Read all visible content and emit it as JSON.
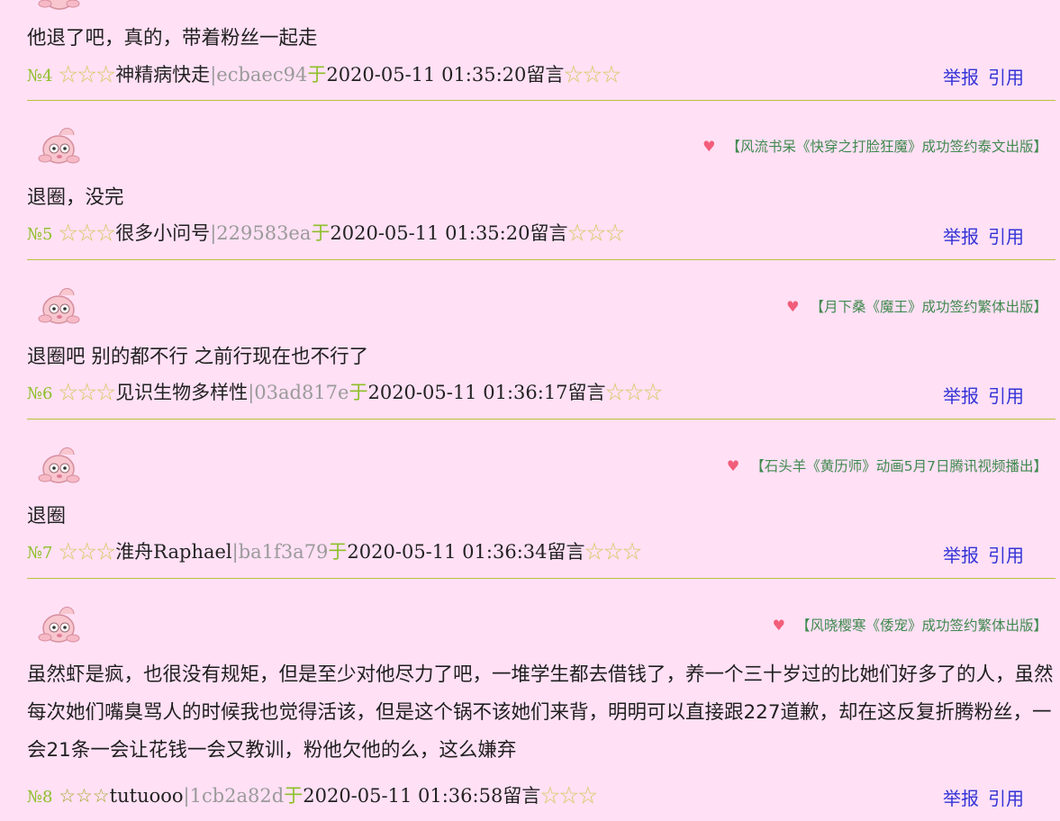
{
  "actions": {
    "report": "举报",
    "quote": "引用"
  },
  "comments": [
    {
      "no": "№4",
      "author": "神精病快走",
      "uid": "ecbaec94",
      "yu": "于",
      "time": "2020-05-11 01:35:20",
      "suffix": "留言",
      "stars_left": "☆☆☆",
      "stars_right": "☆☆☆",
      "text": "他退了吧，真的，带着粉丝一起走",
      "promo": ""
    },
    {
      "no": "№5",
      "author": "很多小问号",
      "uid": "229583ea",
      "yu": "于",
      "time": "2020-05-11 01:35:20",
      "suffix": "留言",
      "stars_left": "☆☆☆",
      "stars_right": "☆☆☆",
      "text": "退圈，没完",
      "promo": "【风流书呆《快穿之打脸狂魔》成功签约泰文出版】"
    },
    {
      "no": "№6",
      "author": "见识生物多样性",
      "uid": "03ad817e",
      "yu": "于",
      "time": "2020-05-11 01:36:17",
      "suffix": "留言",
      "stars_left": "☆☆☆",
      "stars_right": "☆☆☆",
      "text": "退圈吧 别的都不行 之前行现在也不行了",
      "promo": "【月下桑《魔王》成功签约繁体出版】"
    },
    {
      "no": "№7",
      "author": "淮舟Raphael",
      "uid": "ba1f3a79",
      "yu": "于",
      "time": "2020-05-11 01:36:34",
      "suffix": "留言",
      "stars_left": "☆☆☆",
      "stars_right": "☆☆☆",
      "text": "退圈",
      "promo": "【石头羊《黄历师》动画5月7日腾讯视频播出】"
    },
    {
      "no": "№8",
      "author": "tutuooo",
      "uid": "1cb2a82d",
      "yu": "于",
      "time": "2020-05-11 01:36:58",
      "suffix": "留言",
      "stars_left": "☆☆☆",
      "stars_right": "☆☆☆",
      "text": "虽然虾是疯，也很没有规矩，但是至少对他尽力了吧，一堆学生都去借钱了，养一个三十岁过的比她们好多了的人，虽然每次她们嘴臭骂人的时候我也觉得活该，但是这个锅不该她们来背，明明可以直接跟227道歉，却在这反复折腾粉丝，一会21条一会让花钱一会又教训，粉他欠他的么，这么嫌弃",
      "promo": "【风晓樱寒《倭宠》成功签约繁体出版】"
    }
  ]
}
